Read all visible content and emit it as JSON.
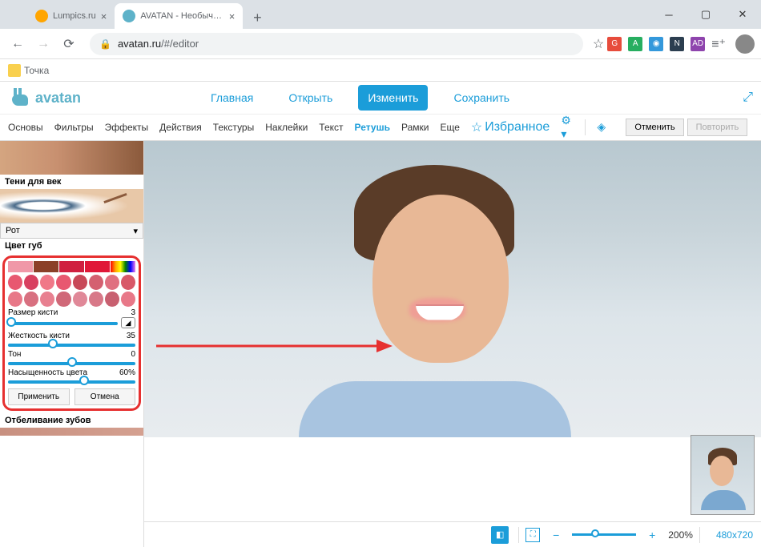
{
  "browser": {
    "tabs": [
      {
        "title": "Lumpics.ru",
        "active": false
      },
      {
        "title": "AVATAN - Необычный Фоторед",
        "active": true
      }
    ],
    "url_domain": "avatan.ru",
    "url_path": "/#/editor",
    "bookmark": "Точка"
  },
  "app": {
    "logo": "avatan",
    "main_nav": {
      "home": "Главная",
      "open": "Открыть",
      "edit": "Изменить",
      "save": "Сохранить"
    },
    "toolbar": {
      "basics": "Основы",
      "filters": "Фильтры",
      "effects": "Эффекты",
      "actions": "Действия",
      "textures": "Текстуры",
      "stickers": "Наклейки",
      "text": "Текст",
      "retouch": "Ретушь",
      "frames": "Рамки",
      "more": "Еще",
      "favorites": "Избранное",
      "undo": "Отменить",
      "redo": "Повторить"
    }
  },
  "sidebar": {
    "eyeshadow_label": "Тени для век",
    "dropdown_mouth": "Рот",
    "lip_color_label": "Цвет губ",
    "whitening_label": "Отбеливание зубов",
    "brush_size_label": "Размер кисти",
    "brush_size_value": "3",
    "brush_hardness_label": "Жесткость кисти",
    "brush_hardness_value": "35",
    "tone_label": "Тон",
    "tone_value": "0",
    "saturation_label": "Насыщенность цвета",
    "saturation_value": "60%",
    "apply_btn": "Применить",
    "cancel_btn": "Отмена",
    "colors_row1": [
      "#f098a8",
      "#8b4028",
      "#d02040",
      "#e01838"
    ],
    "colors_circles": [
      [
        "#e85870",
        "#d84060",
        "#f07888",
        "#e85870",
        "#c84858",
        "#d46070",
        "#e07080",
        "#d85868"
      ],
      [
        "#e87888",
        "#d87080",
        "#e88090",
        "#d06878",
        "#e08898",
        "#d87888",
        "#c86070",
        "#e87888"
      ]
    ]
  },
  "footer": {
    "zoom": "200%",
    "dimensions": "480x720",
    "minus": "−",
    "plus": "+"
  }
}
